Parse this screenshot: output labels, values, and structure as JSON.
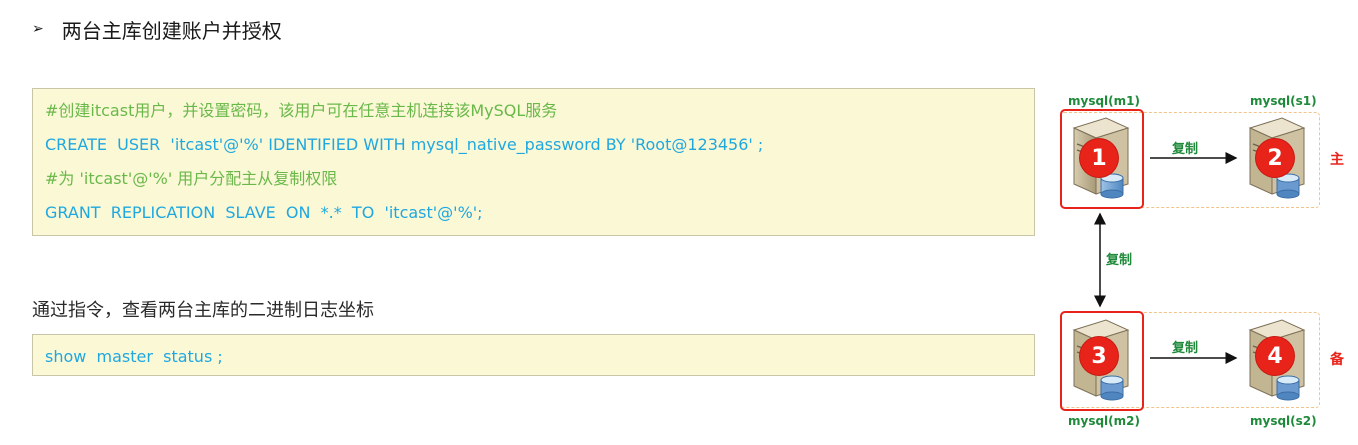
{
  "heading": {
    "bullet": "➢",
    "text": "两台主库创建账户并授权"
  },
  "code_block_1": {
    "lines": [
      {
        "kind": "comment",
        "text": "#创建itcast用户，并设置密码，该用户可在任意主机连接该MySQL服务"
      },
      {
        "kind": "stmt",
        "text": "CREATE  USER  'itcast'@'%' IDENTIFIED WITH mysql_native_password BY 'Root@123456' ;"
      },
      {
        "kind": "comment",
        "text": "#为 'itcast'@'%' 用户分配主从复制权限"
      },
      {
        "kind": "stmt",
        "text": "GRANT  REPLICATION  SLAVE  ON  *.*  TO  'itcast'@'%';"
      }
    ]
  },
  "paragraph": "通过指令，查看两台主库的二进制日志坐标",
  "code_block_2": {
    "line": "show  master  status ;"
  },
  "diagram": {
    "servers": [
      {
        "label": "mysql(m1)",
        "number": "1"
      },
      {
        "label": "mysql(s1)",
        "number": "2"
      },
      {
        "label": "mysql(m2)",
        "number": "3"
      },
      {
        "label": "mysql(s2)",
        "number": "4"
      }
    ],
    "replication_label": "复制",
    "role_primary": "主",
    "role_backup": "备",
    "colors": {
      "badge": "#e8231a",
      "label_green": "#1f8a3a",
      "dash": "#f3c38a"
    }
  }
}
